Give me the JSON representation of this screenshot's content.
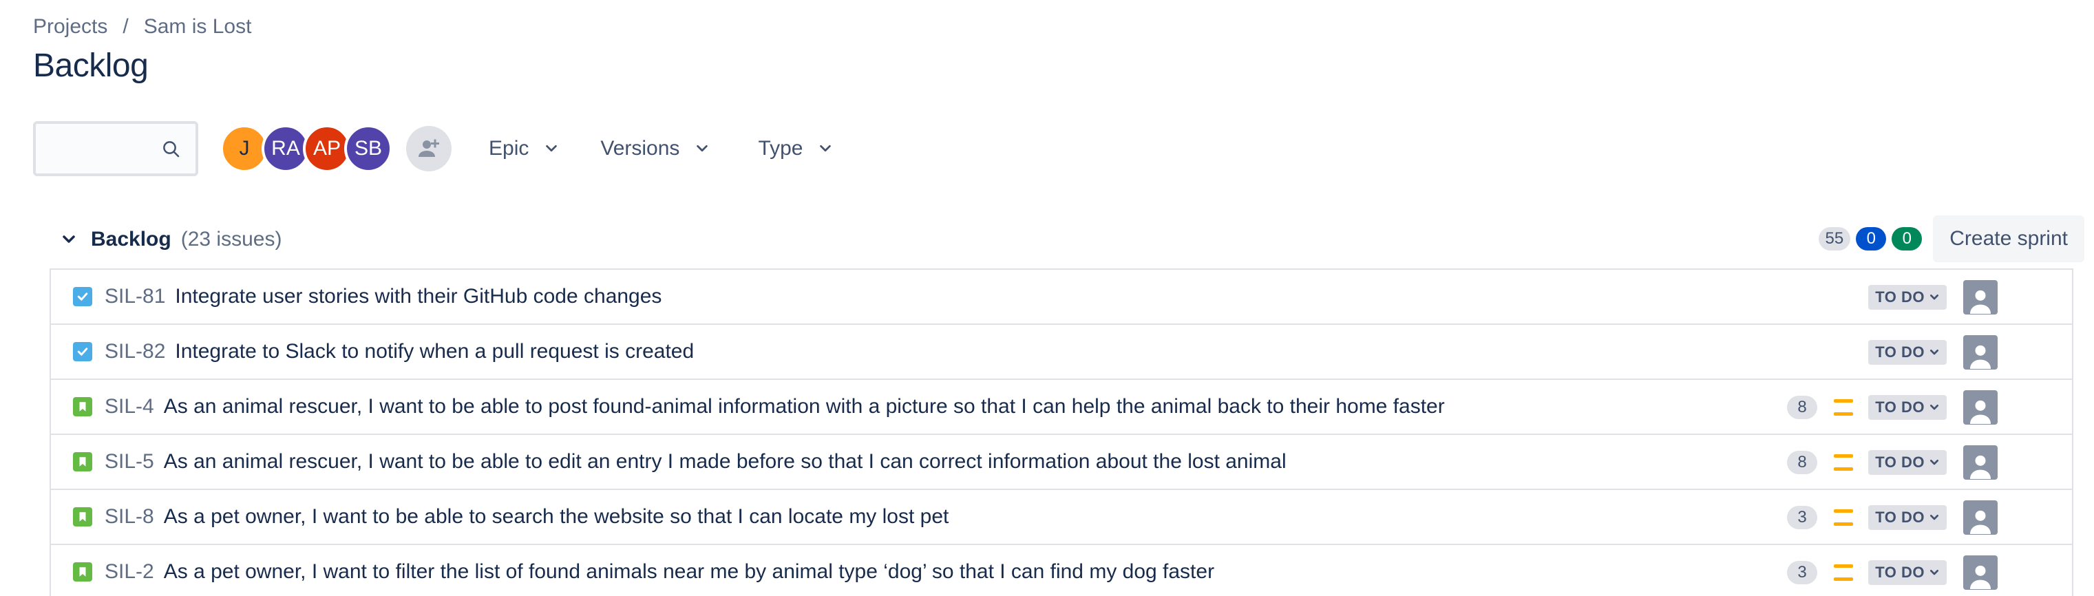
{
  "breadcrumb": {
    "projects": "Projects",
    "separator": "/",
    "project": "Sam is Lost"
  },
  "page": {
    "title": "Backlog"
  },
  "search": {
    "placeholder": "",
    "value": ""
  },
  "avatars": [
    {
      "initials": "J",
      "color": "#ff991f"
    },
    {
      "initials": "RA",
      "color": "#5243aa"
    },
    {
      "initials": "AP",
      "color": "#de350b"
    },
    {
      "initials": "SB",
      "color": "#5243aa"
    }
  ],
  "filters": {
    "epic": "Epic",
    "versions": "Versions",
    "type": "Type"
  },
  "backlog": {
    "title": "Backlog",
    "count": "(23 issues)",
    "pill_todo": "55",
    "pill_inprogress": "0",
    "pill_done": "0",
    "create_sprint": "Create sprint"
  },
  "colors": {
    "task": "#4bade8",
    "story": "#65ba43",
    "priority_medium": "#ffab00",
    "accent_blue": "#0052cc",
    "accent_green": "#00875a"
  },
  "issues": [
    {
      "type": "task",
      "key": "SIL-81",
      "summary": "Integrate user stories with their GitHub code changes",
      "estimate": "",
      "priority": "",
      "status": "TO DO"
    },
    {
      "type": "task",
      "key": "SIL-82",
      "summary": "Integrate to Slack to notify when a pull request is created",
      "estimate": "",
      "priority": "",
      "status": "TO DO"
    },
    {
      "type": "story",
      "key": "SIL-4",
      "summary": "As an animal rescuer, I want to be able to post found-animal information with a picture so that I can help the animal back to their home faster",
      "estimate": "8",
      "priority": "medium",
      "status": "TO DO"
    },
    {
      "type": "story",
      "key": "SIL-5",
      "summary": "As an animal rescuer, I want to be able to edit an entry I made before so that I can correct information about the lost animal",
      "estimate": "8",
      "priority": "medium",
      "status": "TO DO"
    },
    {
      "type": "story",
      "key": "SIL-8",
      "summary": "As a pet owner, I want to be able to search the website so that I can locate my lost pet",
      "estimate": "3",
      "priority": "medium",
      "status": "TO DO"
    },
    {
      "type": "story",
      "key": "SIL-2",
      "summary": "As a pet owner, I want to filter the list of found animals near me by animal type ‘dog’ so that I can find my dog faster",
      "estimate": "3",
      "priority": "medium",
      "status": "TO DO"
    }
  ]
}
